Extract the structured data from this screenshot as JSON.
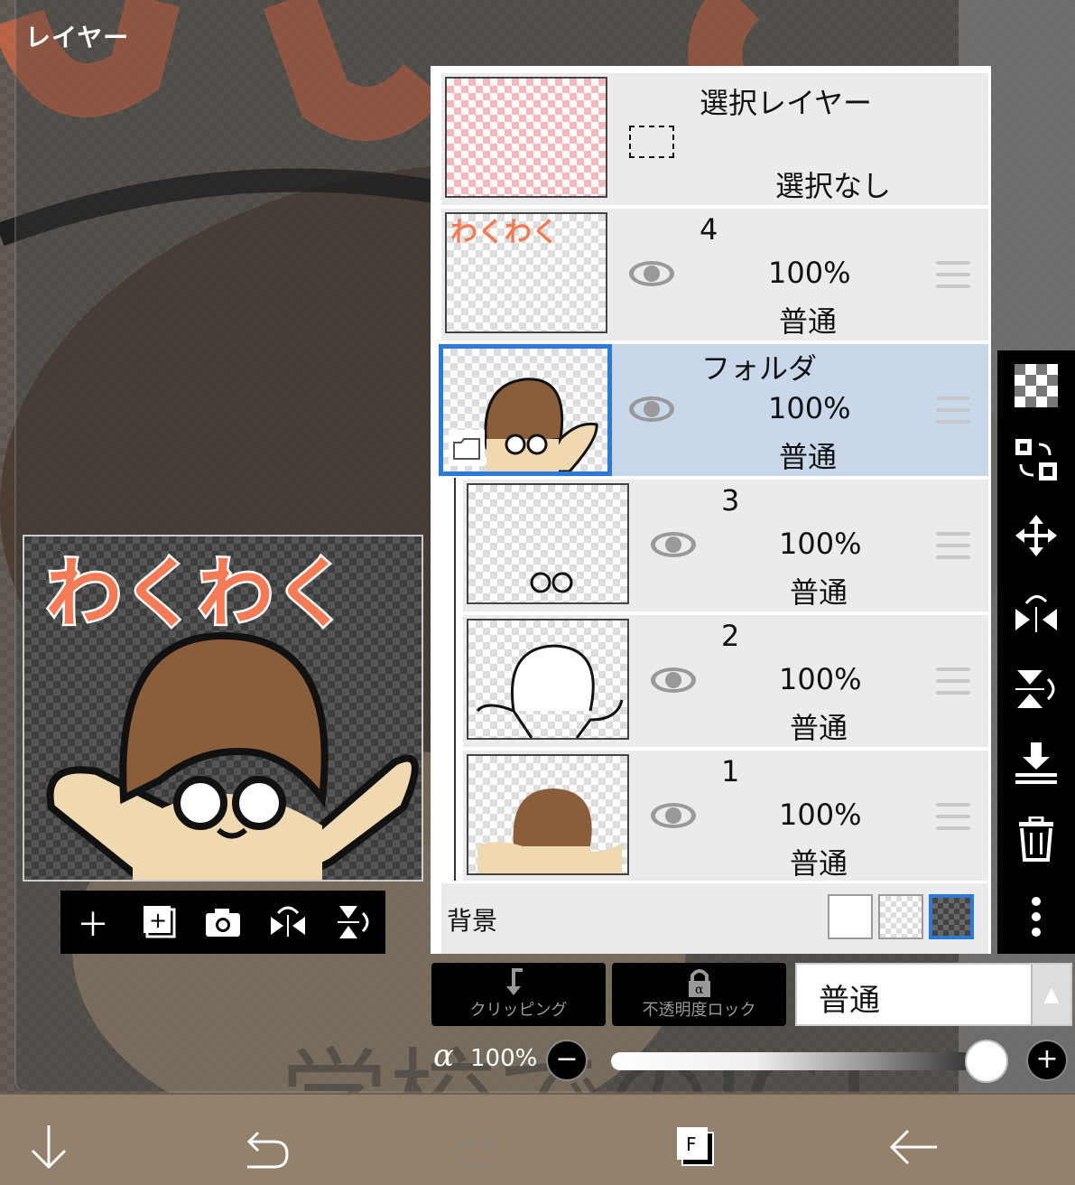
{
  "panel": {
    "title": "レイヤー"
  },
  "preview": {
    "text": "わくわく"
  },
  "preview_toolbar": {
    "icons": [
      "plus-icon",
      "add-layer-icon",
      "camera-icon",
      "flip-horizontal-icon",
      "flip-vertical-icon"
    ]
  },
  "selection_layer": {
    "name": "選択レイヤー",
    "status": "選択なし"
  },
  "layers": [
    {
      "name": "4",
      "opacity": "100%",
      "mode": "普通",
      "selected": false
    },
    {
      "name": "フォルダ",
      "opacity": "100%",
      "mode": "普通",
      "selected": true
    },
    {
      "name": "3",
      "opacity": "100%",
      "mode": "普通",
      "selected": false
    },
    {
      "name": "2",
      "opacity": "100%",
      "mode": "普通",
      "selected": false
    },
    {
      "name": "1",
      "opacity": "100%",
      "mode": "普通",
      "selected": false
    }
  ],
  "background_row": {
    "label": "背景",
    "selected_swatch": "dark-checker"
  },
  "tools": [
    "transparent-icon",
    "swap-selection-icon",
    "move-icon",
    "flip-horizontal-icon",
    "flip-vertical-icon",
    "merge-down-icon",
    "trash-icon",
    "more-icon"
  ],
  "bottom_controls": {
    "clipping_label": "クリッピング",
    "opacity_lock_label": "不透明度ロック",
    "blend_mode": "普通",
    "alpha_symbol": "α",
    "alpha_value": "100%",
    "alpha_level": 1.0
  },
  "bottom_nav": {
    "icons": [
      "arrow-down-icon",
      "undo-icon",
      "redo-icon",
      "layers-icon",
      "back-arrow-icon"
    ]
  },
  "colors": {
    "accent": "#2b7ad8",
    "selected_row": "#c9d7ea",
    "row_bg": "#ebebeb",
    "text_orange": "#f47b55"
  }
}
